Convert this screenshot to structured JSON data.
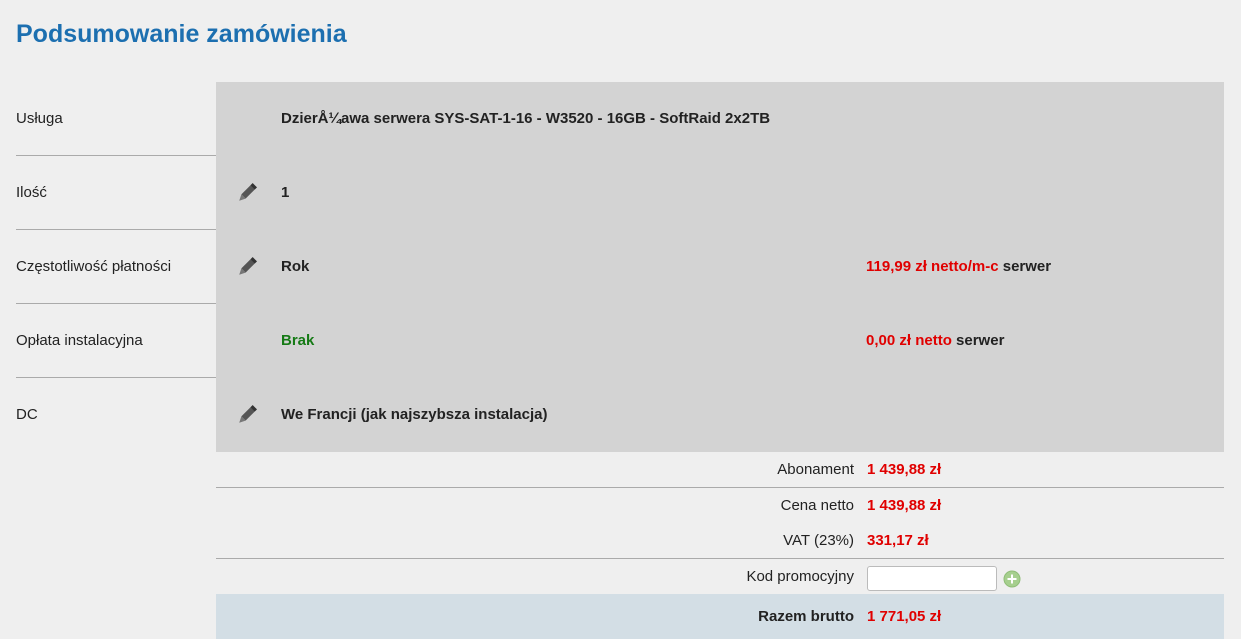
{
  "page_title": "Podsumowanie zamówienia",
  "rows": [
    {
      "label": "Usługa",
      "value": "DzierÅ¼awa serwera SYS-SAT-1-16 - W3520 - 16GB - SoftRaid 2x2TB",
      "editable": false
    },
    {
      "label": "Ilość",
      "value": "1",
      "editable": true,
      "edit_icon": "pencil-icon"
    },
    {
      "label": "Częstotliwość płatności",
      "value": "Rok",
      "editable": true,
      "edit_icon": "pencil-icon",
      "price": {
        "amount": "119,99 zł netto/m-c",
        "suffix": "serwer"
      }
    },
    {
      "label": "Opłata instalacyjna",
      "value": "Brak",
      "value_color": "#157a15",
      "editable": false,
      "price": {
        "amount": "0,00 zł netto",
        "suffix": "serwer"
      }
    },
    {
      "label": "DC",
      "value": "We Francji (jak najszybsza instalacja)",
      "editable": true,
      "edit_icon": "pencil-icon"
    }
  ],
  "summary": {
    "subscription": {
      "label": "Abonament",
      "value": "1 439,88 zł"
    },
    "net_price": {
      "label": "Cena netto",
      "value": "1 439,88 zł"
    },
    "vat": {
      "label": "VAT (23%)",
      "value": "331,17 zł"
    },
    "promo": {
      "label": "Kod promocyjny",
      "value": "",
      "placeholder": "",
      "add_icon": "plus-circle-icon"
    },
    "total": {
      "label": "Razem brutto",
      "value": "1 771,05 zł"
    }
  },
  "colors": {
    "title": "#1c6fb0",
    "price_red": "#e00000",
    "green": "#157a15",
    "cell_bg": "#d3d3d3",
    "total_bg": "#d3dee5"
  }
}
